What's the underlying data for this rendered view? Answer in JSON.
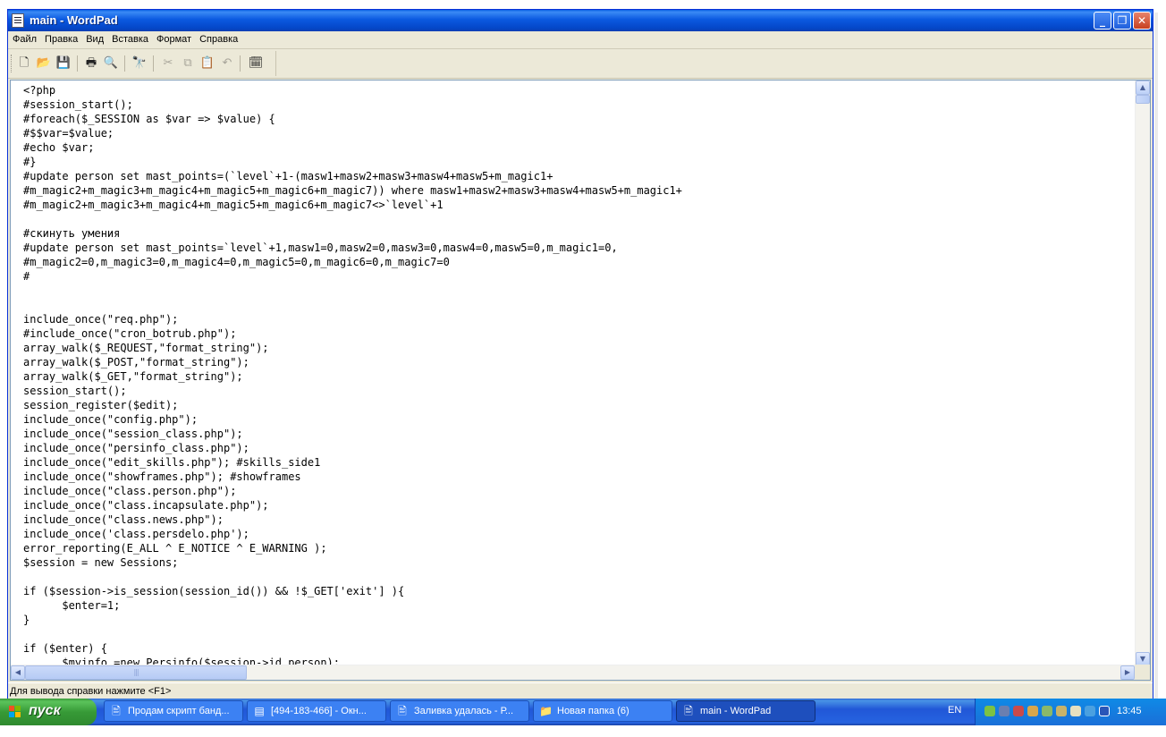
{
  "window": {
    "title": "main - WordPad",
    "buttons": {
      "minimize": "_",
      "maximize": "❐",
      "close": "✕"
    }
  },
  "menu": [
    "Файл",
    "Правка",
    "Вид",
    "Вставка",
    "Формат",
    "Справка"
  ],
  "toolbar": {
    "icons": [
      "new-document-icon",
      "open-folder-icon",
      "save-icon",
      "print-icon",
      "print-preview-icon",
      "find-icon",
      "cut-icon",
      "copy-icon",
      "paste-icon",
      "undo-icon",
      "insert-datetime-icon"
    ],
    "glyphs": {
      "new": "🗋",
      "open": "📂",
      "save": "💾",
      "print": "🖶",
      "preview": "🔍",
      "find": "🔭",
      "cut": "✂",
      "copy": "⧉",
      "paste": "📋",
      "undo": "↶",
      "datetime": "🗓"
    }
  },
  "editor": {
    "lines": [
      "<?php",
      "#session_start();",
      "#foreach($_SESSION as $var => $value) {",
      "#$$var=$value;",
      "#echo $var;",
      "#}",
      "#update person set mast_points=(`level`+1-(masw1+masw2+masw3+masw4+masw5+m_magic1+",
      "#m_magic2+m_magic3+m_magic4+m_magic5+m_magic6+m_magic7)) where masw1+masw2+masw3+masw4+masw5+m_magic1+",
      "#m_magic2+m_magic3+m_magic4+m_magic5+m_magic6+m_magic7<>`level`+1",
      "",
      "#скинуть умения",
      "#update person set mast_points=`level`+1,masw1=0,masw2=0,masw3=0,masw4=0,masw5=0,m_magic1=0,",
      "#m_magic2=0,m_magic3=0,m_magic4=0,m_magic5=0,m_magic6=0,m_magic7=0",
      "#",
      "",
      "",
      "include_once(\"req.php\");",
      "#include_once(\"cron_botrub.php\");",
      "array_walk($_REQUEST,\"format_string\");",
      "array_walk($_POST,\"format_string\");",
      "array_walk($_GET,\"format_string\");",
      "session_start();",
      "session_register($edit);",
      "include_once(\"config.php\");",
      "include_once(\"session_class.php\");",
      "include_once(\"persinfo_class.php\");",
      "include_once(\"edit_skills.php\"); #skills_side1",
      "include_once(\"showframes.php\"); #showframes",
      "include_once(\"class.person.php\");",
      "include_once(\"class.incapsulate.php\");",
      "include_once(\"class.news.php\");",
      "include_once('class.persdelo.php');",
      "error_reporting(E_ALL ^ E_NOTICE ^ E_WARNING );",
      "$session = new Sessions;",
      "",
      "if ($session->is_session(session_id()) && !$_GET['exit'] ){",
      "      $enter=1;",
      "}",
      "",
      "if ($enter) {",
      "      $myinfo =new Persinfo($session->id_person);"
    ]
  },
  "status": {
    "text": "Для вывода справки нажмите <F1>"
  },
  "taskbar": {
    "start_label": "пуск",
    "tasks": [
      {
        "label": "Продам скрипт банд...",
        "icon": "browser-icon",
        "active": false
      },
      {
        "label": "[494-183-466] - Окн...",
        "icon": "chat-window-icon",
        "active": false
      },
      {
        "label": "Заливка удалась - Р...",
        "icon": "wordpad-icon",
        "active": false
      },
      {
        "label": "Новая папка (6)",
        "icon": "folder-icon",
        "active": false
      },
      {
        "label": "main - WordPad",
        "icon": "wordpad-icon",
        "active": true
      }
    ],
    "language": "EN",
    "clock": "13:45"
  }
}
